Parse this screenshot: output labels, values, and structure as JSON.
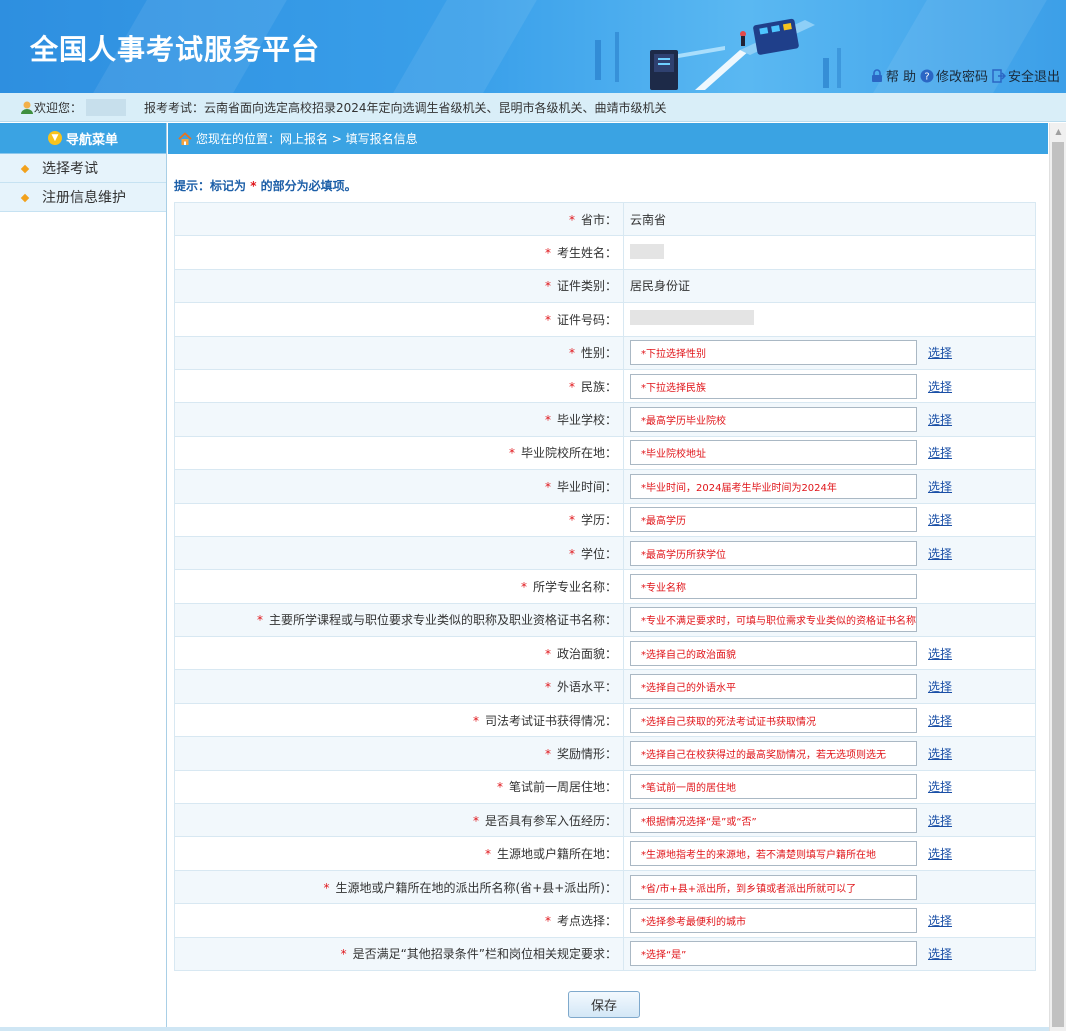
{
  "header": {
    "site_title": "全国人事考试服务平台",
    "links": [
      {
        "icon": "lock-icon",
        "label": "帮 助"
      },
      {
        "icon": "help-icon",
        "label": "修改密码"
      },
      {
        "icon": "exit-icon",
        "label": "安全退出"
      }
    ]
  },
  "welcome": {
    "greeting": "欢迎您：",
    "exam_text": "报考考试：云南省面向选定高校招录2024年定向选调生省级机关、昆明市各级机关、曲靖市级机关"
  },
  "sidebar": {
    "title": "导航菜单",
    "items": [
      {
        "label": "选择考试"
      },
      {
        "label": "注册信息维护"
      }
    ]
  },
  "breadcrumb": "您现在的位置：网上报名 > 填写报名信息",
  "hint": {
    "prefix": "提示：标记为",
    "star": "*",
    "suffix": "的部分为必填项。"
  },
  "form": {
    "pick_label": "选择",
    "rows": [
      {
        "label": "省市：",
        "value": "云南省"
      },
      {
        "label": "考生姓名："
      },
      {
        "label": "证件类别：",
        "value": "居民身份证"
      },
      {
        "label": "证件号码："
      },
      {
        "label": "性别：",
        "input": "*下拉选择性别"
      },
      {
        "label": "民族：",
        "input": "*下拉选择民族"
      },
      {
        "label": "毕业学校：",
        "input": "*最高学历毕业院校"
      },
      {
        "label": "毕业院校所在地：",
        "input": "*毕业院校地址"
      },
      {
        "label": "毕业时间：",
        "input": "*毕业时间，2024届考生毕业时间为2024年"
      },
      {
        "label": "学历：",
        "input": "*最高学历"
      },
      {
        "label": "学位：",
        "input": "*最高学历所获学位"
      },
      {
        "label": "所学专业名称：",
        "input": "*专业名称"
      },
      {
        "label": "主要所学课程或与职位要求专业类似的职称及职业资格证书名称：",
        "input": "*专业不满足要求时，可填与职位需求专业类似的资格证书名称"
      },
      {
        "label": "政治面貌：",
        "input": "*选择自己的政治面貌"
      },
      {
        "label": "外语水平：",
        "input": "*选择自己的外语水平"
      },
      {
        "label": "司法考试证书获得情况：",
        "input": "*选择自己获取的死法考试证书获取情况"
      },
      {
        "label": "奖励情形：",
        "input": "*选择自己在校获得过的最高奖励情况，若无选项则选无"
      },
      {
        "label": "笔试前一周居住地：",
        "input": "*笔试前一周的居住地"
      },
      {
        "label": "是否具有参军入伍经历：",
        "input": "*根据情况选择“是”或“否”"
      },
      {
        "label": "生源地或户籍所在地：",
        "input": "*生源地指考生的来源地，若不清楚则填写户籍所在地"
      },
      {
        "label": "生源地或户籍所在地的派出所名称(省+县+派出所)：",
        "input": "*省/市+县+派出所，到乡镇或者派出所就可以了"
      },
      {
        "label": "考点选择：",
        "input": "*选择参考最便利的城市"
      },
      {
        "label": "是否满足“其他招录条件”栏和岗位相关规定要求：",
        "input": "*选择“是”"
      }
    ]
  },
  "save_label": "保存"
}
